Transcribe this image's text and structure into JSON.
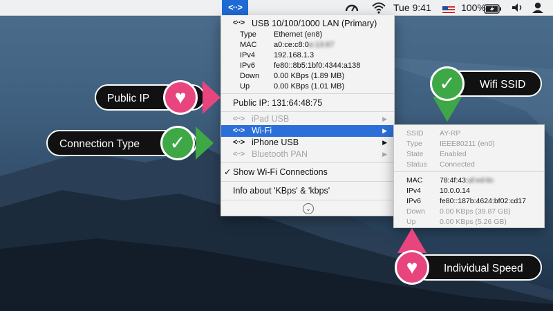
{
  "menubar": {
    "net_icon": "<··>",
    "clock": "Tue 9:41",
    "battery": "100%",
    "icons": [
      "gauge-icon",
      "wifi-icon",
      "flag-icon",
      "battery-icon",
      "volume-icon",
      "user-icon"
    ]
  },
  "menu": {
    "primary": {
      "title": "USB 10/100/1000 LAN (Primary)",
      "details": [
        {
          "label": "Type",
          "value": "Ethernet (en8)"
        },
        {
          "label": "MAC",
          "value": "a0:ce:c8:0",
          "blurred": "e:13:67"
        },
        {
          "label": "IPv4",
          "value": "192.168.1.3"
        },
        {
          "label": "IPv6",
          "value": "fe80::8b5:1bf0:4344:a138"
        },
        {
          "label": "Down",
          "value": "0.00 KBps (1.89 MB)"
        },
        {
          "label": "Up",
          "value": "0.00 KBps (1.01 MB)"
        }
      ]
    },
    "public_ip": "Public IP: 131:64:48:75",
    "interfaces": [
      {
        "label": "iPad USB",
        "state": "disabled"
      },
      {
        "label": "Wi-Fi",
        "state": "selected"
      },
      {
        "label": "iPhone USB",
        "state": "enabled"
      },
      {
        "label": "Bluetooth PAN",
        "state": "disabled"
      }
    ],
    "show_wifi": "Show Wi-Fi Connections",
    "info": "Info about 'KBps' & 'kbps'"
  },
  "wifi_submenu": {
    "rows": [
      {
        "label": "SSID",
        "value": "AY-RP",
        "tone": "gray"
      },
      {
        "label": "Type",
        "value": "IEEE80211 (en0)",
        "tone": "gray"
      },
      {
        "label": "State",
        "value": "Enabled",
        "tone": "gray"
      },
      {
        "label": "Status",
        "value": "Connected",
        "tone": "gray"
      },
      {
        "label": "MAC",
        "value": "78:4f:43:",
        "blurred": "af:ed:6c",
        "tone": "black"
      },
      {
        "label": "IPv4",
        "value": "10.0.0.14",
        "tone": "black"
      },
      {
        "label": "IPv6",
        "value": "fe80::187b:4624:bf02:cd17",
        "tone": "black"
      },
      {
        "label": "Down",
        "value": "0.00 KBps (39.87 GB)",
        "tone": "gray"
      },
      {
        "label": "Up",
        "value": "0.00 KBps (5.26 GB)",
        "tone": "gray"
      }
    ]
  },
  "callouts": {
    "public_ip": "Public IP",
    "connection_type": "Connection Type",
    "wifi_ssid": "Wifi SSID",
    "individual_speed": "Individual Speed"
  },
  "colors": {
    "accent": "#2d6fd9",
    "pink": "#e8457f",
    "green": "#3ea847"
  }
}
